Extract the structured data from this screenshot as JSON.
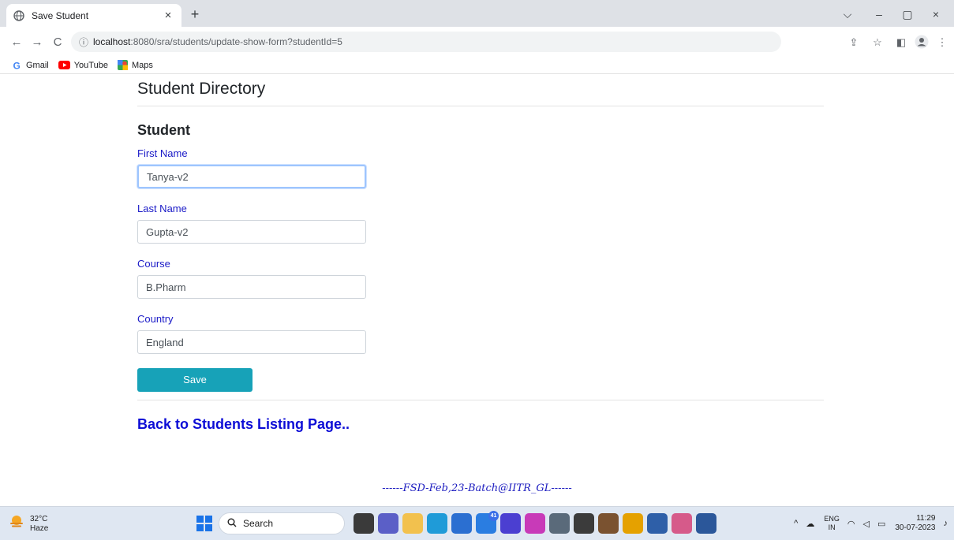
{
  "browser": {
    "tab_title": "Save Student",
    "tab_close": "×",
    "new_tab": "+",
    "url_host": "localhost",
    "url_rest": ":8080/sra/students/update-show-form?studentId=5",
    "nav": {
      "back": "←",
      "forward": "→",
      "reload": "C"
    },
    "window": {
      "tabsearch": "⌵",
      "minimize": "–",
      "restore": "▢",
      "close": "×"
    },
    "bookmarks": [
      {
        "label": "Gmail",
        "icon": "google-icon"
      },
      {
        "label": "YouTube",
        "icon": "youtube-icon"
      },
      {
        "label": "Maps",
        "icon": "maps-icon"
      }
    ]
  },
  "page": {
    "directory_title": "Student Directory",
    "section_title": "Student",
    "fields": {
      "first_name": {
        "label": "First Name",
        "value": "Tanya-v2"
      },
      "last_name": {
        "label": "Last Name",
        "value": "Gupta-v2"
      },
      "course": {
        "label": "Course",
        "value": "B.Pharm"
      },
      "country": {
        "label": "Country",
        "value": "England"
      }
    },
    "save_label": "Save",
    "back_link": "Back to Students Listing Page..",
    "footer": "------FSD-Feb,23-Batch@IITR_GL------"
  },
  "taskbar": {
    "weather_temp": "32°C",
    "weather_cond": "Haze",
    "search_label": "Search",
    "mail_badge": "41",
    "lang_top": "ENG",
    "lang_bottom": "IN",
    "time": "11:29",
    "date": "30-07-2023"
  },
  "colors": {
    "label_blue": "#1a1ac7",
    "save_button": "#17a2b8",
    "link_blue": "#0d0dd6"
  }
}
